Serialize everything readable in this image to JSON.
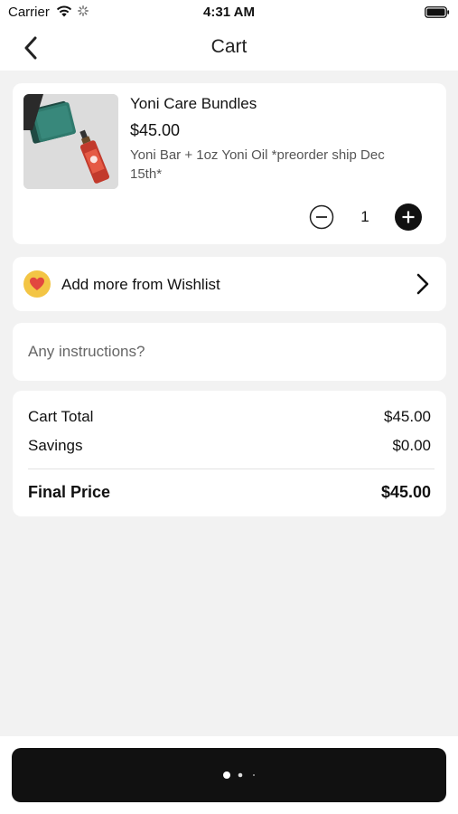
{
  "status_bar": {
    "carrier": "Carrier",
    "time": "4:31 AM"
  },
  "nav": {
    "title": "Cart"
  },
  "product": {
    "name": "Yoni Care Bundles",
    "price": "$45.00",
    "description": "Yoni Bar + 1oz Yoni Oil *preorder ship Dec 15th*",
    "quantity": "1"
  },
  "wishlist": {
    "label": "Add more from Wishlist"
  },
  "instructions": {
    "placeholder": "Any instructions?"
  },
  "totals": {
    "cart_total_label": "Cart Total",
    "cart_total_value": "$45.00",
    "savings_label": "Savings",
    "savings_value": "$0.00",
    "final_label": "Final Price",
    "final_value": "$45.00"
  },
  "colors": {
    "background": "#f2f2f2",
    "card": "#ffffff",
    "checkout_button": "#111111",
    "heart_badge": "#f3c545",
    "heart": "#e2473f"
  },
  "icons": [
    "wifi-icon",
    "spinner-icon",
    "battery-icon",
    "back-icon",
    "minus-icon",
    "plus-icon",
    "heart-icon",
    "chevron-right-icon"
  ]
}
